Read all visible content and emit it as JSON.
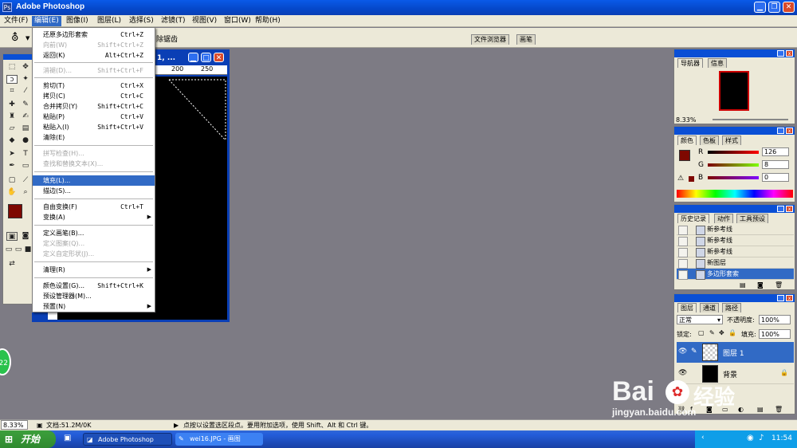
{
  "window": {
    "title": "Adobe Photoshop",
    "logo": "Ps"
  },
  "menubar": [
    {
      "label": "文件(F)"
    },
    {
      "label": "编辑(E)"
    },
    {
      "label": "图像(I)"
    },
    {
      "label": "图层(L)"
    },
    {
      "label": "选择(S)"
    },
    {
      "label": "滤镜(T)"
    },
    {
      "label": "视图(V)"
    },
    {
      "label": "窗口(W)"
    },
    {
      "label": "帮助(H)"
    }
  ],
  "options": {
    "clear_guides": "除锯齿",
    "tab_file_browser": "文件浏览器",
    "tab_brushes": "画笔"
  },
  "document": {
    "title": "1, ...",
    "ruler_200": "200",
    "ruler_250": "250"
  },
  "edit_menu": [
    {
      "label": "还原多边形套索",
      "shortcut": "Ctrl+Z"
    },
    {
      "label": "向前(W)",
      "shortcut": "Shift+Ctrl+Z",
      "disabled": true
    },
    {
      "label": "返回(K)",
      "shortcut": "Alt+Ctrl+Z"
    },
    {
      "label": "消褪(D)...",
      "shortcut": "Shift+Ctrl+F",
      "disabled": true
    },
    {
      "label": "剪切(T)",
      "shortcut": "Ctrl+X"
    },
    {
      "label": "拷贝(C)",
      "shortcut": "Ctrl+C"
    },
    {
      "label": "合并拷贝(Y)",
      "shortcut": "Shift+Ctrl+C"
    },
    {
      "label": "粘贴(P)",
      "shortcut": "Ctrl+V"
    },
    {
      "label": "粘贴入(I)",
      "shortcut": "Shift+Ctrl+V"
    },
    {
      "label": "清除(E)",
      "shortcut": ""
    },
    {
      "label": "拼写检查(H)...",
      "shortcut": "",
      "disabled": true
    },
    {
      "label": "查找和替换文本(X)...",
      "shortcut": "",
      "disabled": true
    },
    {
      "label": "填充(L)...",
      "shortcut": "",
      "highlight": true
    },
    {
      "label": "描边(S)...",
      "shortcut": ""
    },
    {
      "label": "自由变换(F)",
      "shortcut": "Ctrl+T"
    },
    {
      "label": "变换(A)",
      "shortcut": "",
      "submenu": true
    },
    {
      "label": "定义画笔(B)...",
      "shortcut": ""
    },
    {
      "label": "定义图案(Q)...",
      "shortcut": "",
      "disabled": true
    },
    {
      "label": "定义自定形状(J)...",
      "shortcut": "",
      "disabled": true
    },
    {
      "label": "清理(R)",
      "shortcut": "",
      "submenu": true
    },
    {
      "label": "颜色设置(G)...",
      "shortcut": "Shift+Ctrl+K"
    },
    {
      "label": "预设管理器(M)...",
      "shortcut": ""
    },
    {
      "label": "预置(N)",
      "shortcut": "",
      "submenu": true
    }
  ],
  "navigator": {
    "tab1": "导航器",
    "tab2": "信息",
    "zoom": "8.33%"
  },
  "color": {
    "tab1": "颜色",
    "tab2": "色板",
    "tab3": "样式",
    "r_label": "R",
    "g_label": "G",
    "b_label": "B",
    "r": "126",
    "g": "8",
    "b": "0",
    "fg": "#7e0800",
    "bg": "#000000"
  },
  "history": {
    "tab1": "历史记录",
    "tab2": "动作",
    "tab3": "工具预设",
    "items": [
      {
        "label": "新参考线"
      },
      {
        "label": "新参考线"
      },
      {
        "label": "新参考线"
      },
      {
        "label": "新图层"
      },
      {
        "label": "多边形套索",
        "selected": true
      }
    ]
  },
  "layers": {
    "tab1": "图层",
    "tab2": "通道",
    "tab3": "路径",
    "blend": "正常",
    "opacity_label": "不透明度:",
    "opacity": "100%",
    "lock_label": "锁定:",
    "fill_label": "填充:",
    "fill": "100%",
    "items": [
      {
        "label": "图层 1",
        "selected": true
      },
      {
        "label": "背景"
      }
    ]
  },
  "status": {
    "zoom": "8.33%",
    "doc": "文档:51.2M/0K",
    "hint": "点按以设置选区段点。要用附加选项，使用 Shift、Alt 和 Ctrl 键。"
  },
  "taskbar": {
    "start": "开始",
    "task1": "Adobe Photoshop",
    "task2": "wei16.JPG - 画图",
    "clock": "11:54"
  },
  "badge": "22",
  "watermark": {
    "logo": "Bai",
    "brand": "经验",
    "url": "jingyan.baidu.com"
  }
}
